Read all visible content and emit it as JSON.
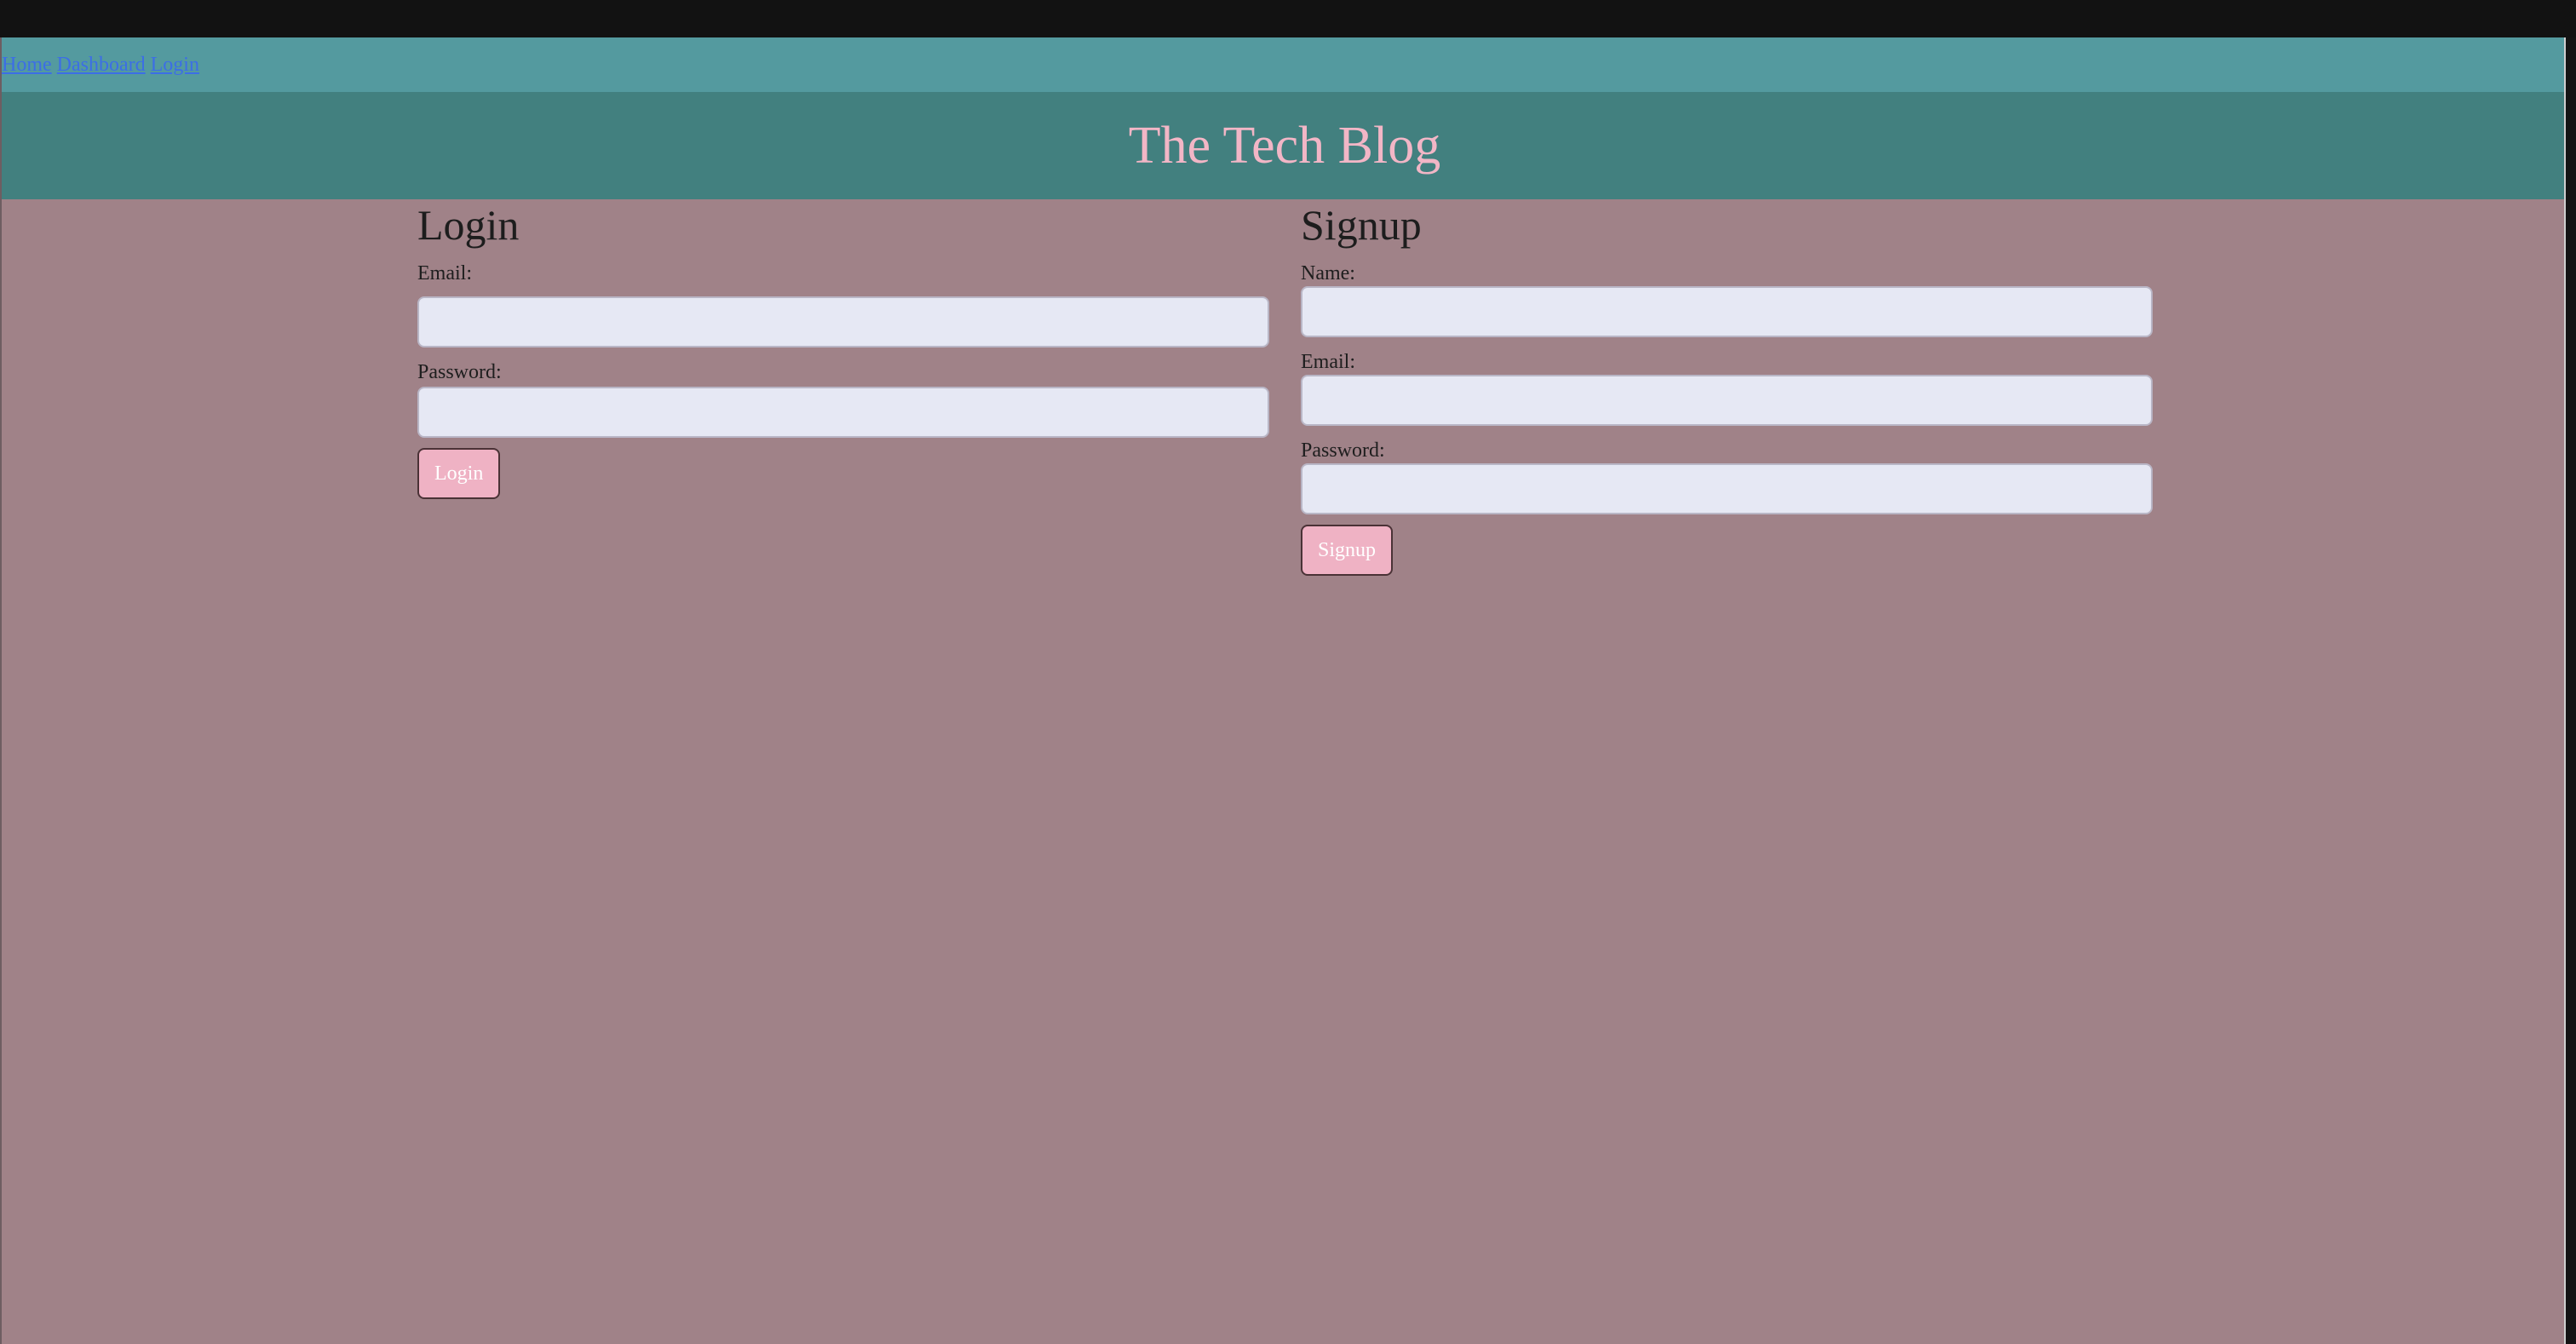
{
  "nav": {
    "links": [
      "Home",
      "Dashboard",
      "Login"
    ]
  },
  "header": {
    "title": "The Tech Blog"
  },
  "login": {
    "heading": "Login",
    "email_label": "Email:",
    "password_label": "Password:",
    "button_label": "Login"
  },
  "signup": {
    "heading": "Signup",
    "name_label": "Name:",
    "email_label": "Email:",
    "password_label": "Password:",
    "button_label": "Signup"
  },
  "colors": {
    "page_bg": "#a08288",
    "nav_bg": "#549a9f",
    "header_bg": "#42807f",
    "title_color": "#f2b6c6",
    "button_bg": "#efb2c4",
    "input_bg": "#e6e8f4",
    "link_color": "#3c6ee6"
  }
}
